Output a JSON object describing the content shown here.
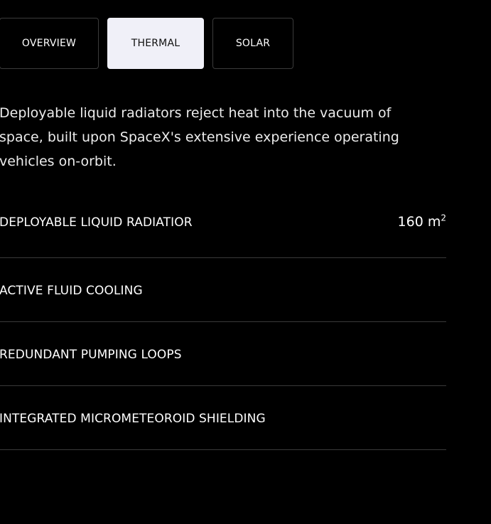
{
  "tabs": [
    {
      "label": "OVERVIEW",
      "active": false
    },
    {
      "label": "THERMAL",
      "active": true
    },
    {
      "label": "SOLAR",
      "active": false
    }
  ],
  "description": "Deployable liquid radiators reject heat into the vacuum of space, built upon SpaceX's extensive experience operating vehicles on-orbit.",
  "specs": [
    {
      "label": "DEPLOYABLE LIQUID RADIATIOR",
      "value": "160 m",
      "value_sup": "2"
    },
    {
      "label": "ACTIVE FLUID COOLING"
    },
    {
      "label": "REDUNDANT PUMPING LOOPS"
    },
    {
      "label": "INTEGRATED MICROMETEOROID SHIELDING"
    }
  ],
  "colors": {
    "background": "#000000",
    "text": "#ffffff",
    "active_tab_bg": "#f0f0f8",
    "border": "#3a3a3a"
  }
}
